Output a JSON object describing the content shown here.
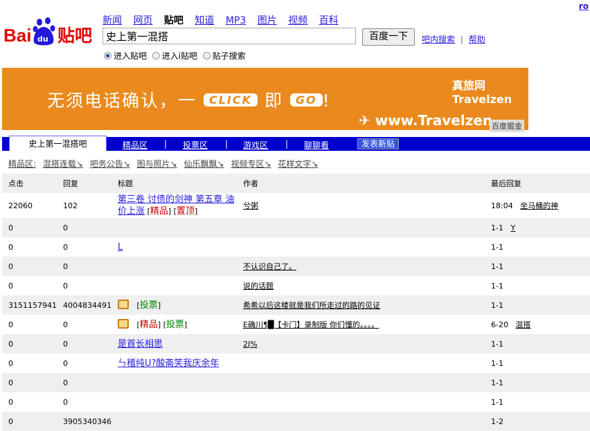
{
  "login": "ro",
  "logo": {
    "text": "Bai du 贴吧"
  },
  "nav": [
    {
      "label": "新闻"
    },
    {
      "label": "网页"
    },
    {
      "label": "贴吧",
      "current": true
    },
    {
      "label": "知道"
    },
    {
      "label": "MP3"
    },
    {
      "label": "图片"
    },
    {
      "label": "视频"
    },
    {
      "label": "百科"
    }
  ],
  "search": {
    "value": "史上第一混搭",
    "button": "百度一下",
    "in_bar": "吧内搜索",
    "help": "帮助",
    "sep": "|"
  },
  "radios": [
    {
      "label": "进入贴吧",
      "checked": true
    },
    {
      "label": "进入i贴吧"
    },
    {
      "label": "贴子搜索"
    }
  ],
  "banner": {
    "text1": "无须电话确认，一",
    "click": "CLICK",
    "mid": "即",
    "go": "GO",
    "end": "!",
    "url": "✈ www.Travelzen",
    "brand": "真旅网 Travelzen",
    "tag": "百度掘金"
  },
  "tabs": {
    "current": "史上第一混搭吧",
    "items": [
      "精品区",
      "投票区",
      "游戏区",
      "聊聊看"
    ],
    "post": "发表新贴",
    "sep": "|"
  },
  "sub": {
    "label": "精品区:",
    "items": [
      "混搭连载↘",
      "吧务公告↘",
      "图与照片↘",
      "仙乐飘飘↘",
      "视频专区↘",
      "花样文字↘"
    ]
  },
  "table": {
    "headers": [
      "点击",
      "回复",
      "标题",
      "作者",
      "最后回复"
    ],
    "rows": [
      {
        "clicks": "22060",
        "replies": "102",
        "title": "第三卷 讨债的剑神 第五章 油价上涨",
        "tags": [
          "精品",
          "置顶"
        ],
        "author": "兮粥",
        "last_time": "18:04",
        "last_user": "坐马桶的神"
      },
      {
        "clicks": "0",
        "replies": "0",
        "title": "",
        "author": "",
        "last_time": "1-1",
        "last_user": "Y"
      },
      {
        "clicks": "0",
        "replies": "0",
        "title": "L",
        "author": "",
        "last_time": "1-1",
        "last_user": ""
      },
      {
        "clicks": "0",
        "replies": "0",
        "title": "",
        "author": "不认识自己了。",
        "last_time": "1-1",
        "last_user": ""
      },
      {
        "clicks": "0",
        "replies": "0",
        "title": "",
        "author": "说的话题",
        "last_time": "1-1",
        "last_user": ""
      },
      {
        "clicks": "3151157941",
        "replies": "4004834491",
        "book": true,
        "title": "",
        "tags": [
          "投票"
        ],
        "author": "希希以后这楼就是我们所走过的路的见证",
        "last_time": "1-1",
        "last_user": ""
      },
      {
        "clicks": "0",
        "replies": "0",
        "book": true,
        "title": "",
        "tags": [
          "精品",
          "投票"
        ],
        "author": "E确川¶█【卡门】录制版 你们懂的。。。。",
        "last_time": "6-20",
        "last_user": "混搭"
      },
      {
        "clicks": "0",
        "replies": "0",
        "title": "是首长相思",
        "author": "2J%",
        "last_time": "1-1",
        "last_user": ""
      },
      {
        "clicks": "0",
        "replies": "0",
        "title": "ㄣ稽纯U?酸斋笑我庆余年",
        "author": "",
        "last_time": "1-1",
        "last_user": ""
      },
      {
        "clicks": "0",
        "replies": "0",
        "title": "",
        "author": "",
        "last_time": "1-1",
        "last_user": ""
      },
      {
        "clicks": "0",
        "replies": "0",
        "title": "",
        "author": "",
        "last_time": "1-1",
        "last_user": ""
      },
      {
        "clicks": "0",
        "replies": "3905340346",
        "title": "",
        "author": "",
        "last_time": "1-2",
        "last_user": ""
      }
    ]
  }
}
